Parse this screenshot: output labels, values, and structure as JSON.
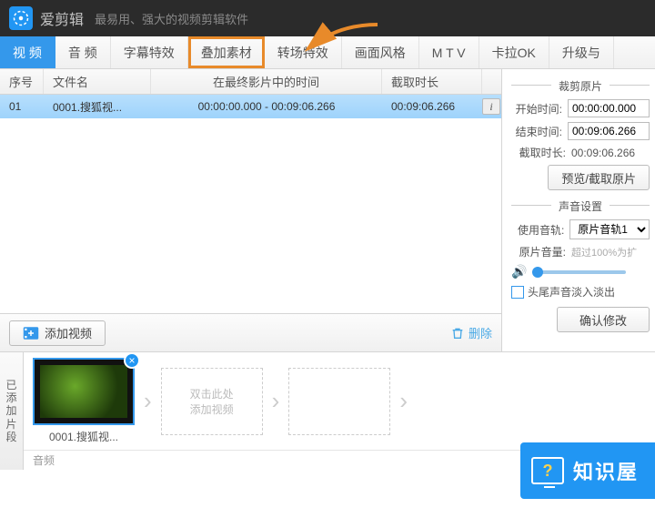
{
  "header": {
    "app_name": "爱剪辑",
    "slogan": "最易用、强大的视频剪辑软件"
  },
  "tabs": [
    "视 频",
    "音 频",
    "字幕特效",
    "叠加素材",
    "转场特效",
    "画面风格",
    "M T V",
    "卡拉OK",
    "升级与"
  ],
  "table": {
    "headers": {
      "idx": "序号",
      "name": "文件名",
      "time": "在最终影片中的时间",
      "dur": "截取时长"
    },
    "rows": [
      {
        "idx": "01",
        "name": "0001.搜狐视...",
        "time": "00:00:00.000 - 00:09:06.266",
        "dur": "00:09:06.266"
      }
    ]
  },
  "actions": {
    "add": "添加视频",
    "delete": "删除"
  },
  "trim": {
    "title": "裁剪原片",
    "start_label": "开始时间:",
    "start": "00:00:00.000",
    "end_label": "结束时间:",
    "end": "00:09:06.266",
    "dur_label": "截取时长:",
    "dur": "00:09:06.266",
    "preview_btn": "预览/截取原片"
  },
  "audio": {
    "title": "声音设置",
    "track_label": "使用音轨:",
    "track": "原片音轨1",
    "vol_label": "原片音量:",
    "vol_hint": "超过100%为扩",
    "fade": "头尾声音淡入淡出"
  },
  "confirm": "确认修改",
  "clips": {
    "side_label": "已添加片段",
    "item_name": "0001.搜狐视...",
    "placeholder1": "双击此处",
    "placeholder2": "添加视频",
    "footer": "音频"
  },
  "brand": "知识屋"
}
